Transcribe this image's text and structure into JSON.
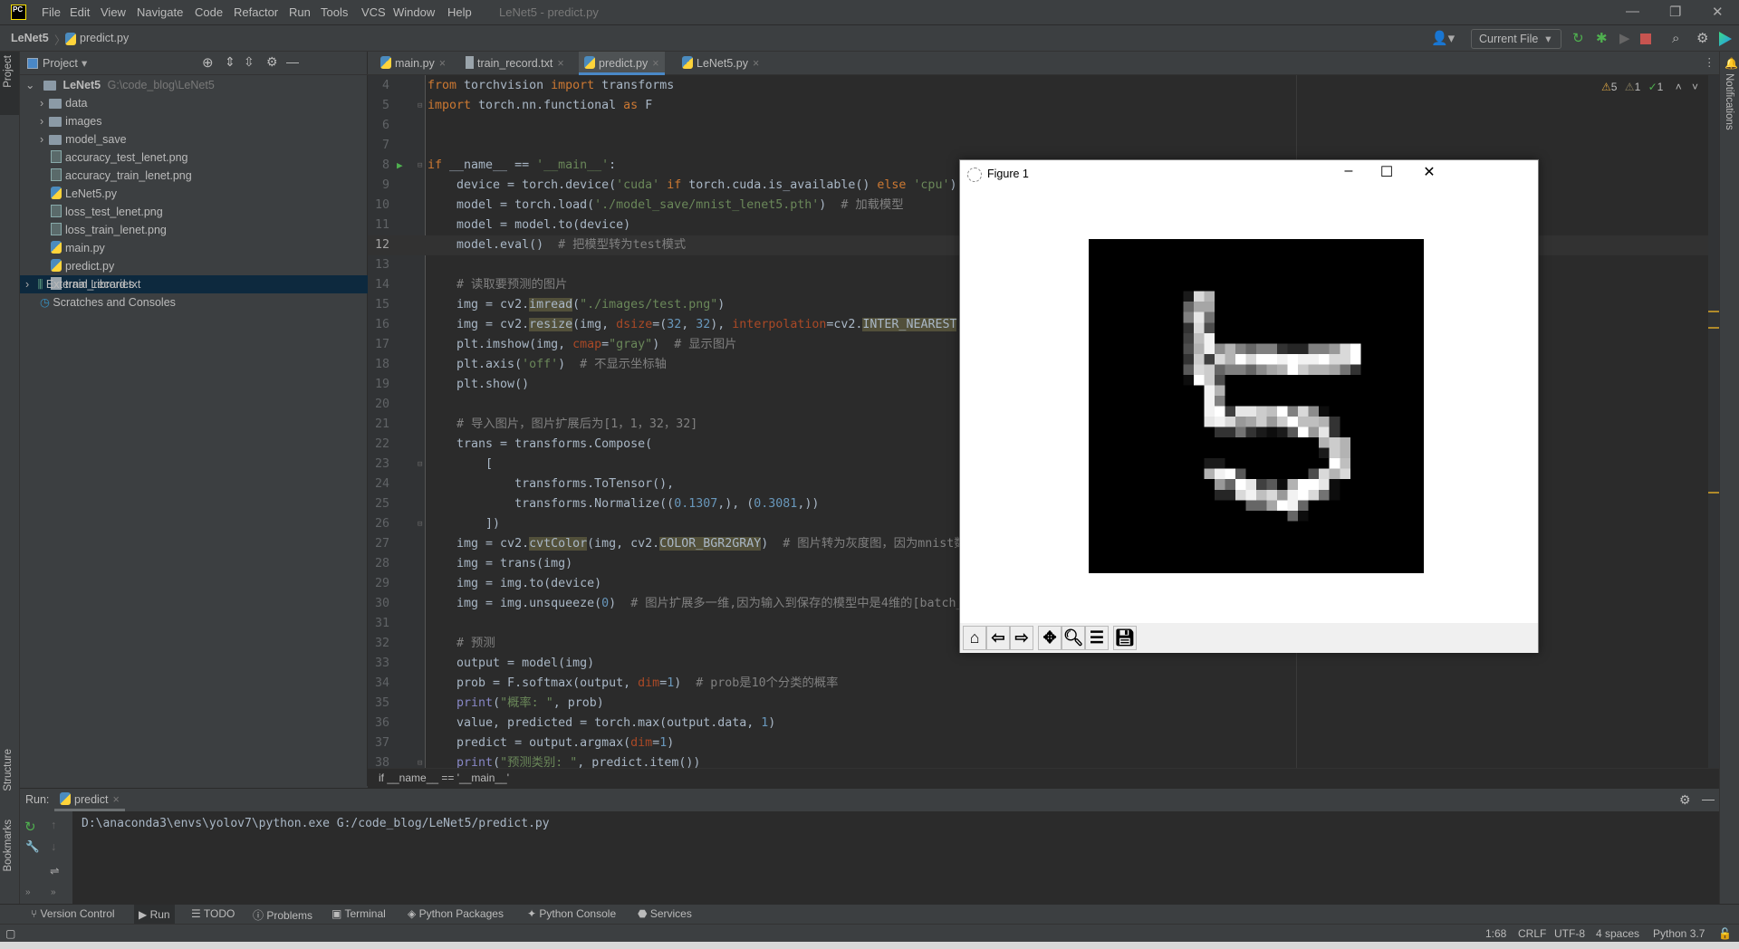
{
  "window": {
    "title": "LeNet5 - predict.py",
    "logo": "PC"
  },
  "menu": [
    "File",
    "Edit",
    "View",
    "Navigate",
    "Code",
    "Refactor",
    "Run",
    "Tools",
    "VCS",
    "Window",
    "Help"
  ],
  "nav": {
    "project": "LeNet5",
    "file": "predict.py",
    "run_config": "Current File"
  },
  "project_panel": {
    "title": "Project",
    "root": {
      "name": "LeNet5",
      "path": "G:\\code_blog\\LeNet5"
    },
    "items": [
      {
        "name": "data",
        "type": "folder"
      },
      {
        "name": "images",
        "type": "folder"
      },
      {
        "name": "model_save",
        "type": "folder"
      },
      {
        "name": "accuracy_test_lenet.png",
        "type": "png"
      },
      {
        "name": "accuracy_train_lenet.png",
        "type": "png"
      },
      {
        "name": "LeNet5.py",
        "type": "py"
      },
      {
        "name": "loss_test_lenet.png",
        "type": "png"
      },
      {
        "name": "loss_train_lenet.png",
        "type": "png"
      },
      {
        "name": "main.py",
        "type": "py"
      },
      {
        "name": "predict.py",
        "type": "py"
      },
      {
        "name": "train_record.txt",
        "type": "txt",
        "selected": true
      }
    ],
    "external": "External Libraries",
    "scratches": "Scratches and Consoles"
  },
  "side_tabs": {
    "project": "Project",
    "structure": "Structure",
    "bookmarks": "Bookmarks",
    "notifications": "Notifications"
  },
  "editor_tabs": [
    {
      "label": "main.py"
    },
    {
      "label": "train_record.txt"
    },
    {
      "label": "predict.py",
      "active": true
    },
    {
      "label": "LeNet5.py"
    }
  ],
  "inspections": {
    "warnings": "5",
    "weak_warnings": "1",
    "typos": "1"
  },
  "code": {
    "first_line": 4,
    "current_line": 12,
    "lines": [
      [
        [
          "from",
          "k"
        ],
        [
          " torchvision ",
          "t"
        ],
        [
          "import",
          "k"
        ],
        [
          " transforms",
          "t"
        ]
      ],
      [
        [
          "import",
          "k"
        ],
        [
          " torch.nn.functional ",
          "t"
        ],
        [
          "as",
          "k"
        ],
        [
          " F",
          "t"
        ]
      ],
      [],
      [],
      [
        [
          "if",
          "k"
        ],
        [
          " __name__ == ",
          "t"
        ],
        [
          "'__main__'",
          "s"
        ],
        [
          ":",
          "t"
        ]
      ],
      [
        [
          "    device = torch.device(",
          "t"
        ],
        [
          "'cuda'",
          "s"
        ],
        [
          " ",
          "t"
        ],
        [
          "if",
          "k"
        ],
        [
          " torch.cuda.is_available() ",
          "t"
        ],
        [
          "else",
          "k"
        ],
        [
          " ",
          "t"
        ],
        [
          "'cpu'",
          "s"
        ],
        [
          ")",
          "t"
        ]
      ],
      [
        [
          "    model = torch.load(",
          "t"
        ],
        [
          "'./model_save/mnist_lenet5.pth'",
          "s"
        ],
        [
          ")  ",
          "t"
        ],
        [
          "# 加载模型",
          "c"
        ]
      ],
      [
        [
          "    model = model.to(device)",
          "t"
        ]
      ],
      [
        [
          "    model.eval()  ",
          "t"
        ],
        [
          "# 把模型转为test模式",
          "c"
        ]
      ],
      [],
      [
        [
          "    # 读取要预测的图片",
          "c"
        ]
      ],
      [
        [
          "    img = cv2.",
          "t"
        ],
        [
          "imread",
          "h"
        ],
        [
          "(",
          "t"
        ],
        [
          "\"./images/test.png\"",
          "s"
        ],
        [
          ")",
          "t"
        ]
      ],
      [
        [
          "    img = cv2.",
          "t"
        ],
        [
          "resize",
          "h"
        ],
        [
          "(img, ",
          "t"
        ],
        [
          "dsize",
          "p"
        ],
        [
          "=(",
          "t"
        ],
        [
          "32",
          "n"
        ],
        [
          ", ",
          "t"
        ],
        [
          "32",
          "n"
        ],
        [
          "), ",
          "t"
        ],
        [
          "interpolation",
          "p"
        ],
        [
          "=cv2.",
          "t"
        ],
        [
          "INTER_NEAREST",
          "h"
        ],
        [
          ")",
          "t"
        ]
      ],
      [
        [
          "    plt.imshow(img, ",
          "t"
        ],
        [
          "cmap",
          "p"
        ],
        [
          "=",
          "t"
        ],
        [
          "\"gray\"",
          "s"
        ],
        [
          ")  ",
          "t"
        ],
        [
          "# 显示图片",
          "c"
        ]
      ],
      [
        [
          "    plt.axis(",
          "t"
        ],
        [
          "'off'",
          "s"
        ],
        [
          ")  ",
          "t"
        ],
        [
          "# 不显示坐标轴",
          "c"
        ]
      ],
      [
        [
          "    plt.show()",
          "t"
        ]
      ],
      [],
      [
        [
          "    # 导入图片，图片扩展后为[1，1，32，32]",
          "c"
        ]
      ],
      [
        [
          "    trans = transforms.Compose(",
          "t"
        ]
      ],
      [
        [
          "        [",
          "t"
        ]
      ],
      [
        [
          "            transforms.ToTensor(),",
          "t"
        ]
      ],
      [
        [
          "            transforms.Normalize((",
          "t"
        ],
        [
          "0.1307",
          "n"
        ],
        [
          ",), (",
          "t"
        ],
        [
          "0.3081",
          "n"
        ],
        [
          ",))",
          "t"
        ]
      ],
      [
        [
          "        ])",
          "t"
        ]
      ],
      [
        [
          "    img = cv2.",
          "t"
        ],
        [
          "cvtColor",
          "h"
        ],
        [
          "(img, cv2.",
          "t"
        ],
        [
          "COLOR_BGR2GRAY",
          "h"
        ],
        [
          ")  ",
          "t"
        ],
        [
          "# 图片转为灰度图，因为mnist数",
          "c"
        ]
      ],
      [
        [
          "    img = trans(img)",
          "t"
        ]
      ],
      [
        [
          "    img = img.to(device)",
          "t"
        ]
      ],
      [
        [
          "    img = img.unsqueeze(",
          "t"
        ],
        [
          "0",
          "n"
        ],
        [
          ")  ",
          "t"
        ],
        [
          "# 图片扩展多一维,因为输入到保存的模型中是4维的[batch_",
          "c"
        ]
      ],
      [],
      [
        [
          "    # 预测",
          "c"
        ]
      ],
      [
        [
          "    output = model(img)",
          "t"
        ]
      ],
      [
        [
          "    prob = F.softmax(output, ",
          "t"
        ],
        [
          "dim",
          "p"
        ],
        [
          "=",
          "t"
        ],
        [
          "1",
          "n"
        ],
        [
          ")  ",
          "t"
        ],
        [
          "# prob是10个分类的概率",
          "c"
        ]
      ],
      [
        [
          "    ",
          "t"
        ],
        [
          "print",
          "b"
        ],
        [
          "(",
          "t"
        ],
        [
          "\"概率: \"",
          "s"
        ],
        [
          ", prob)",
          "t"
        ]
      ],
      [
        [
          "    value, predicted = torch.max(output.data, ",
          "t"
        ],
        [
          "1",
          "n"
        ],
        [
          ")",
          "t"
        ]
      ],
      [
        [
          "    predict = output.argmax(",
          "t"
        ],
        [
          "dim",
          "p"
        ],
        [
          "=",
          "t"
        ],
        [
          "1",
          "n"
        ],
        [
          ")",
          "t"
        ]
      ],
      [
        [
          "    ",
          "t"
        ],
        [
          "print",
          "b"
        ],
        [
          "(",
          "t"
        ],
        [
          "\"预测类别: \"",
          "s"
        ],
        [
          ", predict.item())",
          "t"
        ]
      ]
    ]
  },
  "breadcrumb": "if __name__ == '__main__'",
  "run": {
    "label": "Run:",
    "tab": "predict",
    "command": "D:\\anaconda3\\envs\\yolov7\\python.exe G:/code_blog/LeNet5/predict.py"
  },
  "tool_strip": [
    "Version Control",
    "Run",
    "TODO",
    "Problems",
    "Terminal",
    "Python Packages",
    "Python Console",
    "Services"
  ],
  "status": {
    "position": "1:68",
    "line_sep": "CRLF",
    "encoding": "UTF-8",
    "indent": "4 spaces",
    "interpreter": "Python 3.7"
  },
  "figure": {
    "title": "Figure 1",
    "toolbar": [
      "home-icon",
      "back-icon",
      "forward-icon",
      "pan-icon",
      "zoom-icon",
      "configure-subplots-icon",
      "save-icon"
    ]
  },
  "colors": {
    "accent": "#4a88c7",
    "editor_bg": "#2b2b2b",
    "panel_bg": "#3c3f41",
    "selection": "#0d293e"
  }
}
